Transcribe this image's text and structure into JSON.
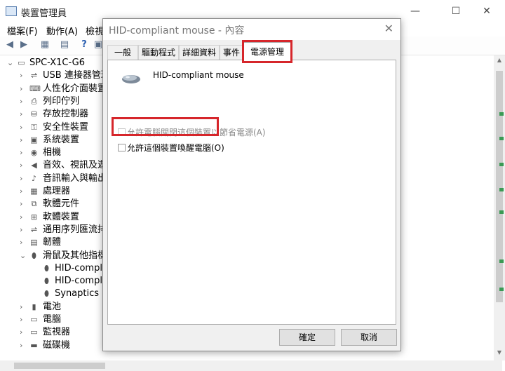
{
  "app": {
    "title": "裝置管理員"
  },
  "window_controls": {
    "minimize": "—",
    "maximize": "☐",
    "close": "✕"
  },
  "menu": {
    "file": "檔案(F)",
    "action": "動作(A)",
    "view": "檢視"
  },
  "tree": {
    "root": "SPC-X1C-G6",
    "items": [
      {
        "label": "USB 連接器管理",
        "icon": "usb-icon"
      },
      {
        "label": "人性化介面裝置",
        "icon": "hid-icon"
      },
      {
        "label": "列印佇列",
        "icon": "printer-icon"
      },
      {
        "label": "存放控制器",
        "icon": "storage-icon"
      },
      {
        "label": "安全性裝置",
        "icon": "security-icon"
      },
      {
        "label": "系統裝置",
        "icon": "system-icon"
      },
      {
        "label": "相機",
        "icon": "camera-icon"
      },
      {
        "label": "音效、視訊及遊",
        "icon": "speaker-icon"
      },
      {
        "label": "音訊輸入與輸出",
        "icon": "audio-icon"
      },
      {
        "label": "處理器",
        "icon": "processor-icon"
      },
      {
        "label": "軟體元件",
        "icon": "component-icon"
      },
      {
        "label": "軟體裝置",
        "icon": "software-icon"
      },
      {
        "label": "通用序列匯流排",
        "icon": "usb-icon"
      },
      {
        "label": "韌體",
        "icon": "firmware-icon"
      },
      {
        "label": "滑鼠及其他指標",
        "icon": "mouse-icon"
      }
    ],
    "children": [
      {
        "label": "HID-compli",
        "icon": "mouse-icon"
      },
      {
        "label": "HID-compli",
        "icon": "mouse-icon"
      },
      {
        "label": "Synaptics Po",
        "icon": "mouse-icon"
      }
    ],
    "after": [
      {
        "label": "電池",
        "icon": "battery-icon"
      },
      {
        "label": "電腦",
        "icon": "computer-icon"
      },
      {
        "label": "監視器",
        "icon": "monitor-icon"
      },
      {
        "label": "磁碟機",
        "icon": "disk-icon"
      }
    ]
  },
  "dialog": {
    "title": "HID-compliant mouse - 內容",
    "close": "✕",
    "tabs": [
      "一般",
      "驅動程式",
      "詳細資料",
      "事件",
      "電源管理"
    ],
    "active_tab": 4,
    "device_name": "HID-compliant mouse",
    "options": [
      {
        "label": "允許電腦關閉這個裝置以節省電源(A)",
        "checked": false,
        "enabled": false
      },
      {
        "label": "允許這個裝置喚醒電腦(O)",
        "checked": false,
        "enabled": true
      }
    ],
    "ok_label": "確定",
    "cancel_label": "取消"
  },
  "colors": {
    "highlight": "#d6262b",
    "dialog_bg": "#f0f0f0"
  }
}
